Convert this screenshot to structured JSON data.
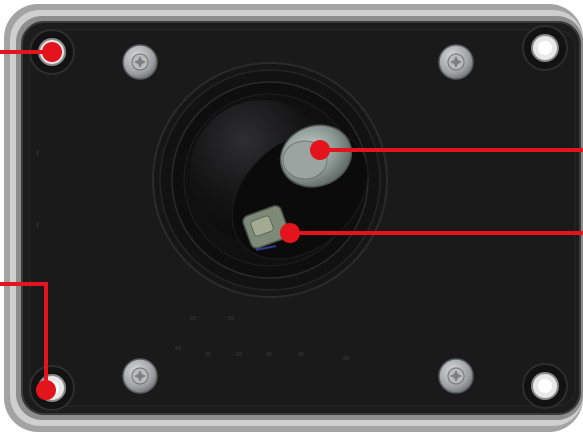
{
  "colors": {
    "background": "#ffffff",
    "frame": "#9a9a9a",
    "frame_inner": "#3c3c3c",
    "panel": "#1b1b1c",
    "panel_edge": "#2a2a2a",
    "screw_metal": "#a7a9ab",
    "dome": "#0f0f10",
    "lens": "#9aa6a2",
    "sensor": "#7f8b7a",
    "callout": "#e3141b"
  },
  "components": {
    "corner_mounts": [
      "top-left",
      "top-right",
      "bottom-left",
      "bottom-right"
    ],
    "torx_screws": [
      "top-left",
      "top-right",
      "bottom-left",
      "bottom-right"
    ],
    "callouts": [
      "top-left-mount",
      "bottom-left-mount",
      "lens",
      "sensor"
    ]
  }
}
